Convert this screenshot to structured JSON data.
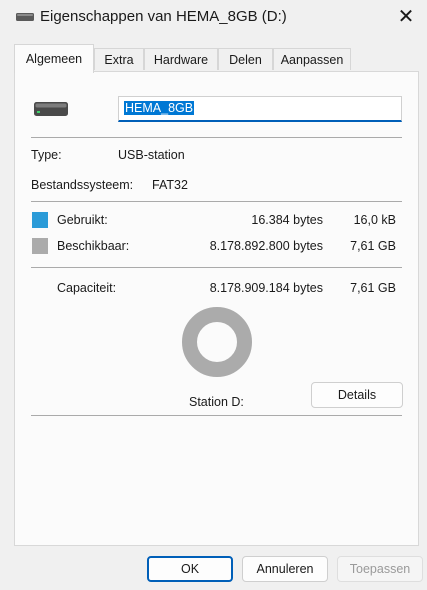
{
  "window": {
    "title": "Eigenschappen van HEMA_8GB (D:)",
    "close_glyph": "✕"
  },
  "tabs": [
    {
      "label": "Algemeen",
      "active": true
    },
    {
      "label": "Extra",
      "active": false
    },
    {
      "label": "Hardware",
      "active": false
    },
    {
      "label": "Delen",
      "active": false
    },
    {
      "label": "Aanpassen",
      "active": false
    }
  ],
  "general": {
    "drive_name": "HEMA_8GB",
    "type_label": "Type:",
    "type_value": "USB-station",
    "fs_label": "Bestandssysteem:",
    "fs_value": "FAT32",
    "used": {
      "label": "Gebruikt:",
      "bytes": "16.384 bytes",
      "size": "16,0 kB",
      "color": "#2b9bd8"
    },
    "free": {
      "label": "Beschikbaar:",
      "bytes": "8.178.892.800 bytes",
      "size": "7,61 GB",
      "color": "#ababab"
    },
    "capacity": {
      "label": "Capaciteit:",
      "bytes": "8.178.909.184 bytes",
      "size": "7,61 GB"
    },
    "used_fraction": 2e-06,
    "station_label": "Station D:",
    "details_button": "Details"
  },
  "footer": {
    "ok": "OK",
    "cancel": "Annuleren",
    "apply": "Toepassen"
  },
  "icons": {
    "title": "drive-icon",
    "drive": "usb-drive-icon",
    "close": "close-icon"
  }
}
